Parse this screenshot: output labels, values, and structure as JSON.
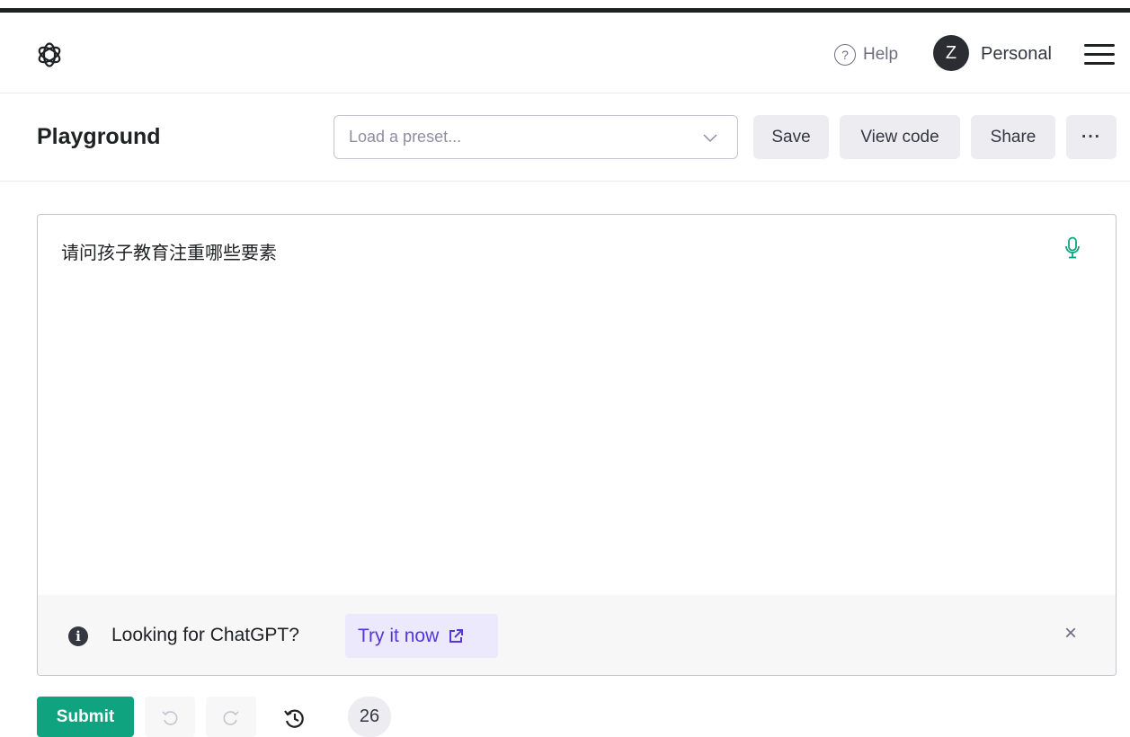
{
  "nav": {
    "logo_icon": "openai-logo-icon",
    "help_label": "Help",
    "help_icon_glyph": "?",
    "avatar_initial": "Z",
    "account_label": "Personal",
    "menu_icon": "hamburger-icon"
  },
  "toolbar": {
    "title": "Playground",
    "preset_placeholder": "Load a preset...",
    "save_label": "Save",
    "view_code_label": "View code",
    "share_label": "Share",
    "more_label": "···"
  },
  "editor": {
    "prompt_text": "请问孩子教育注重哪些要素",
    "mic_icon": "microphone-icon"
  },
  "banner": {
    "info_glyph": "i",
    "message": "Looking for ChatGPT?",
    "cta_label": "Try it now",
    "close_glyph": "×"
  },
  "footer": {
    "submit_label": "Submit",
    "token_count": "26"
  },
  "colors": {
    "accent_green": "#10a37f",
    "link_purple": "#5436da",
    "mic_green": "#10a37f"
  }
}
